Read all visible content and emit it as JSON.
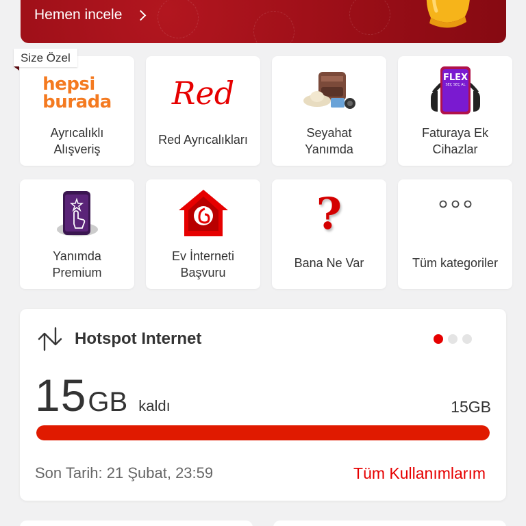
{
  "banner": {
    "cta_label": "Hemen incele",
    "icon": "chevron-right-icon",
    "bg_color": "#a0101a"
  },
  "special_tag": "Size Özel",
  "tiles": [
    {
      "label": "Ayrıcalıklı Alışveriş",
      "logo_line1": "hepsi",
      "logo_line2": "burada",
      "icon": "hepsiburada-logo"
    },
    {
      "label": "Red Ayrıcalıkları",
      "logo_text": "Red",
      "icon": "red-logo"
    },
    {
      "label": "Seyahat Yanımda",
      "icon": "travel-luggage-icon"
    },
    {
      "label": "Faturaya Ek Cihazlar",
      "logo_text": "FLEX",
      "logo_sub": "SEÇ SEÇ AL",
      "icon": "flex-phone-icon"
    },
    {
      "label": "Yanımda Premium",
      "icon": "premium-phone-icon"
    },
    {
      "label": "Ev İnterneti Başvuru",
      "icon": "home-internet-icon"
    },
    {
      "label": "Bana Ne Var",
      "logo_text": "?",
      "icon": "question-mark-icon"
    },
    {
      "label": "Tüm kategoriler",
      "icon": "more-dots-icon"
    }
  ],
  "usage": {
    "title": "Hotspot Internet",
    "icon": "transfer-arrows-icon",
    "remaining_value": "15",
    "remaining_unit": "GB",
    "remaining_suffix": "kaldı",
    "total": "15GB",
    "used_fraction": 1.0,
    "deadline": "Son Tarih: 21 Şubat, 23:59",
    "all_usage_link": "Tüm Kullanımlarım",
    "pager": {
      "count": 3,
      "active": 0
    },
    "accent": "#e60000"
  }
}
